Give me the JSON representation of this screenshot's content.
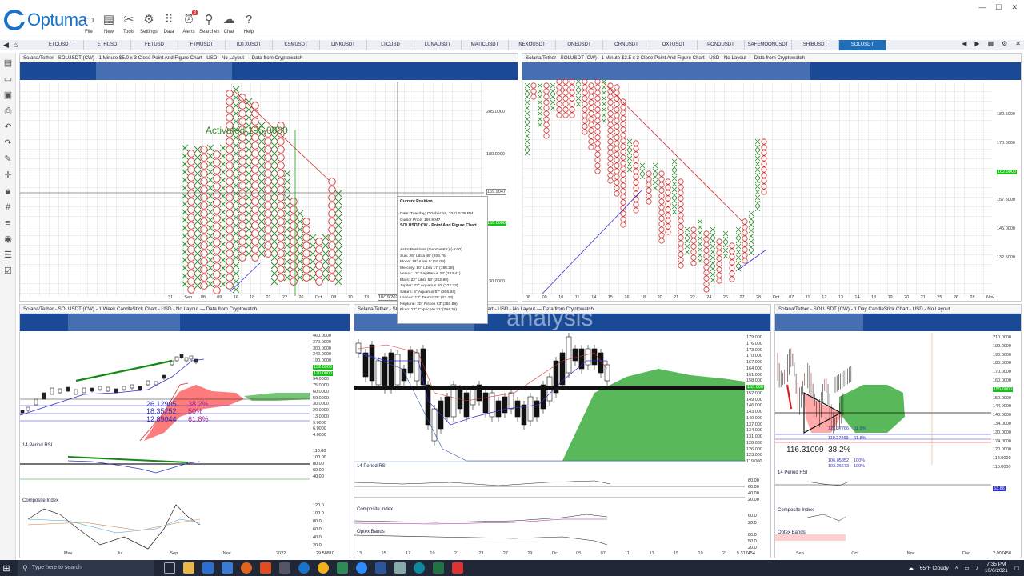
{
  "app": {
    "name": "Optuma"
  },
  "toolbar": [
    {
      "label": "File",
      "icon": "folder-icon"
    },
    {
      "label": "New",
      "icon": "new-doc-icon"
    },
    {
      "label": "Tools",
      "icon": "tools-icon"
    },
    {
      "label": "Settings",
      "icon": "gear-icon"
    },
    {
      "label": "Data",
      "icon": "data-icon"
    },
    {
      "label": "Alerts",
      "icon": "alarm-icon",
      "badge": "3"
    },
    {
      "label": "Searches",
      "icon": "search-icon"
    },
    {
      "label": "Chat",
      "icon": "chat-icon"
    },
    {
      "label": "Help",
      "icon": "help-icon"
    }
  ],
  "symbols": [
    "ETCUSDT",
    "ETHUSD",
    "FETUSD",
    "FTMUSDT",
    "IOTXUSDT",
    "KSMUSDT",
    "LINKUSDT",
    "LTCUSD",
    "LUNAUSDT",
    "MATICUSDT",
    "NEXOUSDT",
    "ONEUSDT",
    "ORNUSDT",
    "OXTUSDT",
    "PONDUSDT",
    "SAFEMOONUSDT",
    "SHIBUSDT",
    "SOLUSDT"
  ],
  "active_symbol": "SOLUSDT",
  "panes": {
    "pf1": {
      "title": "Solana/Tether - SOLUSDT (CW) - 1 Minute $5.0 x 3 Close Point And Figure Chart - USD - No Layout — Data from Cryptowatch",
      "annotation": "Activated 195.0000",
      "price_labels": [
        "205.0000",
        "180.0000",
        "169.9047",
        "155.0000",
        "130.0000"
      ],
      "x_labels": [
        "31",
        "Sep",
        "08",
        "09",
        "16",
        "18",
        "21",
        "22",
        "26",
        "Oct",
        "08",
        "10",
        "13"
      ]
    },
    "pf2": {
      "title": "Solana/Tether - SOLUSDT (CW) - 1 Minute $2.5 x 3 Close Point And Figure Chart - USD - No Layout — Data from Cryptowatch",
      "price_labels": [
        "182.5000",
        "170.0000",
        "162.5000",
        "157.5000",
        "145.0000",
        "132.5000"
      ],
      "x_labels": [
        "08",
        "09",
        "10",
        "11",
        "14",
        "15",
        "16",
        "18",
        "20",
        "21",
        "22",
        "24",
        "26",
        "27",
        "28",
        "Oct",
        "07",
        "11",
        "12",
        "13",
        "14",
        "18",
        "19",
        "20",
        "21",
        "25",
        "26",
        "28",
        "Nov"
      ]
    },
    "week": {
      "title": "Solana/Tether - SOLUSDT (CW) - 1 Week CandleStick Chart - USD - No Layout — Data from Cryptowatch",
      "price_labels": [
        "460.0000",
        "370.0000",
        "300.0000",
        "240.0000",
        "190.0000",
        "152.0000",
        "120.0000",
        "94.0000",
        "75.0000",
        "60.0000",
        "50.0000",
        "30.0000",
        "20.0000",
        "13.0000",
        "9.0000",
        "6.0000",
        "4.0000"
      ],
      "fib": [
        {
          "value": "26.12905",
          "pct": "38.2%"
        },
        {
          "value": "18.35252",
          "pct": "50%"
        },
        {
          "value": "12.89044",
          "pct": "61.8%"
        }
      ],
      "rsi_label": "14 Period RSI",
      "rsi_levels": [
        "110.00",
        "100.00",
        "80.00",
        "60.00",
        "40.00"
      ],
      "composite_label": "Composite Index",
      "composite_levels": [
        "120.0",
        "100.0",
        "80.0",
        "60.0",
        "40.0",
        "20.0"
      ],
      "x_labels": [
        "Mav",
        "Jul",
        "Sep",
        "Nov",
        "2022"
      ],
      "corner_value": "29.58810"
    },
    "min": {
      "title": "Solana/Tether - SOLUSDT (CW) - 1 Minute CandleStick Chart - USD - No Layout — Data from Cryptowatch",
      "watermark": "analysis",
      "price_labels": [
        "179.000",
        "176.000",
        "173.000",
        "170.000",
        "167.000",
        "164.000",
        "161.000",
        "158.000",
        "155.000",
        "152.000",
        "149.000",
        "146.000",
        "143.000",
        "140.000",
        "137.000",
        "134.000",
        "131.000",
        "128.000",
        "126.000",
        "123.000",
        "119.000"
      ],
      "rsi_label": "14 Period RSI",
      "rsi_levels": [
        "80.00",
        "60.00",
        "40.00",
        "20.00"
      ],
      "composite_label": "Composite Index",
      "composite_levels": [
        "60.0",
        "20.0"
      ],
      "optex_label": "Optex Bands",
      "optex_levels": [
        "80.0",
        "50.0",
        "20.0"
      ],
      "x_labels": [
        "13",
        "15",
        "17",
        "19",
        "21",
        "23",
        "27",
        "29",
        "Oct",
        "05",
        "07",
        "11",
        "13",
        "15",
        "19",
        "21"
      ],
      "corner_value": "5.317454"
    },
    "day": {
      "title": "Solana/Tether - SOLUSDT (CW) - 1 Day CandleStick Chart - USD - No Layout",
      "price_labels": [
        "210.0000",
        "199.0000",
        "190.0000",
        "180.0000",
        "170.0000",
        "160.0000",
        "155.0000",
        "150.0000",
        "144.0000",
        "140.0000",
        "134.0000",
        "130.0000",
        "124.0000",
        "120.0000",
        "113.0000",
        "110.0000"
      ],
      "fib_main": {
        "value": "116.31099",
        "pct": "38.2%"
      },
      "fib_small": [
        {
          "value": "127.37766",
          "pct": "61.8%"
        },
        {
          "value": "119.27269",
          "pct": "61.8%"
        },
        {
          "value": "106.05852",
          "pct": "100%"
        },
        {
          "value": "103.26673",
          "pct": "100%"
        }
      ],
      "rsi_label": "14 Period RSI",
      "rsi_value": "53.86",
      "composite_label": "Composite Index",
      "optex_label": "Optex Bands",
      "x_labels": [
        "Sep",
        "Oct",
        "Nov",
        "Dec"
      ],
      "corner_value": "2.007458"
    }
  },
  "tooltip": {
    "title": "Current Position",
    "date": "Date: Tuesday, October 19, 2021 5:39 PM",
    "cursor": "Cursor Price: 169.9047",
    "chart": "SOLUSDT:CW - Point And Figure Chart",
    "astro_header": "Astro Positions (GeoCentric) (-5:00)",
    "astro": [
      "Sun: 26° Libra 46' (206.76)",
      "Moon: 19° Aries 5' (19.09)",
      "Mercury: 10° Libra 17' (190.28)",
      "Venus: 13° Sagittarius 24' (253.41)",
      "Mars: 22° Libra 53' (202.89)",
      "Jupiter: 22° Aquarius 20' (322.33)",
      "Saturn: 6° Aquarius 57' (306.94)",
      "Uranus: 13° Taurus 26' (43.43)",
      "Neptune: 20° Pisces 53' (350.88)",
      "Pluto: 24° Capricorn 21' (294.36)"
    ]
  },
  "crosshair_date": "10/19/2021",
  "taskbar": {
    "search_placeholder": "Type here to search",
    "weather": "65°F  Cloudy",
    "time": "7:35 PM",
    "date": "10/6/2021"
  },
  "colors": {
    "accent": "#1f6fb8",
    "pf_x": "#2e8b2e",
    "pf_o": "#d23030",
    "cloud": "#3cab3c"
  }
}
